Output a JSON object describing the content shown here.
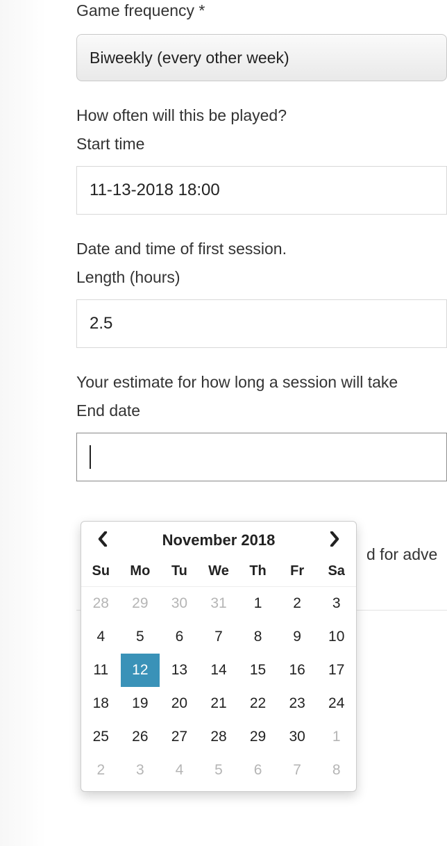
{
  "form": {
    "frequency": {
      "label": "Game frequency *",
      "value": "Biweekly (every other week)",
      "help": "How often will this be played?"
    },
    "start_time": {
      "label": "Start time",
      "value": "11-13-2018 18:00",
      "help": "Date and time of first session."
    },
    "length": {
      "label": "Length (hours)",
      "value": "2.5",
      "help": "Your estimate for how long a session will take"
    },
    "end_date": {
      "label": "End date",
      "value": "",
      "behind_fragment": "d for adve"
    }
  },
  "datepicker": {
    "title": "November 2018",
    "dow": [
      "Su",
      "Mo",
      "Tu",
      "We",
      "Th",
      "Fr",
      "Sa"
    ],
    "weeks": [
      [
        {
          "d": 28,
          "muted": true
        },
        {
          "d": 29,
          "muted": true
        },
        {
          "d": 30,
          "muted": true
        },
        {
          "d": 31,
          "muted": true
        },
        {
          "d": 1
        },
        {
          "d": 2
        },
        {
          "d": 3
        }
      ],
      [
        {
          "d": 4
        },
        {
          "d": 5
        },
        {
          "d": 6
        },
        {
          "d": 7
        },
        {
          "d": 8
        },
        {
          "d": 9
        },
        {
          "d": 10
        }
      ],
      [
        {
          "d": 11
        },
        {
          "d": 12,
          "selected": true
        },
        {
          "d": 13
        },
        {
          "d": 14
        },
        {
          "d": 15
        },
        {
          "d": 16
        },
        {
          "d": 17
        }
      ],
      [
        {
          "d": 18
        },
        {
          "d": 19
        },
        {
          "d": 20
        },
        {
          "d": 21
        },
        {
          "d": 22
        },
        {
          "d": 23
        },
        {
          "d": 24
        }
      ],
      [
        {
          "d": 25
        },
        {
          "d": 26
        },
        {
          "d": 27
        },
        {
          "d": 28
        },
        {
          "d": 29
        },
        {
          "d": 30
        },
        {
          "d": 1,
          "muted": true
        }
      ],
      [
        {
          "d": 2,
          "muted": true
        },
        {
          "d": 3,
          "muted": true
        },
        {
          "d": 4,
          "muted": true
        },
        {
          "d": 5,
          "muted": true
        },
        {
          "d": 6,
          "muted": true
        },
        {
          "d": 7,
          "muted": true
        },
        {
          "d": 8,
          "muted": true
        }
      ]
    ]
  }
}
